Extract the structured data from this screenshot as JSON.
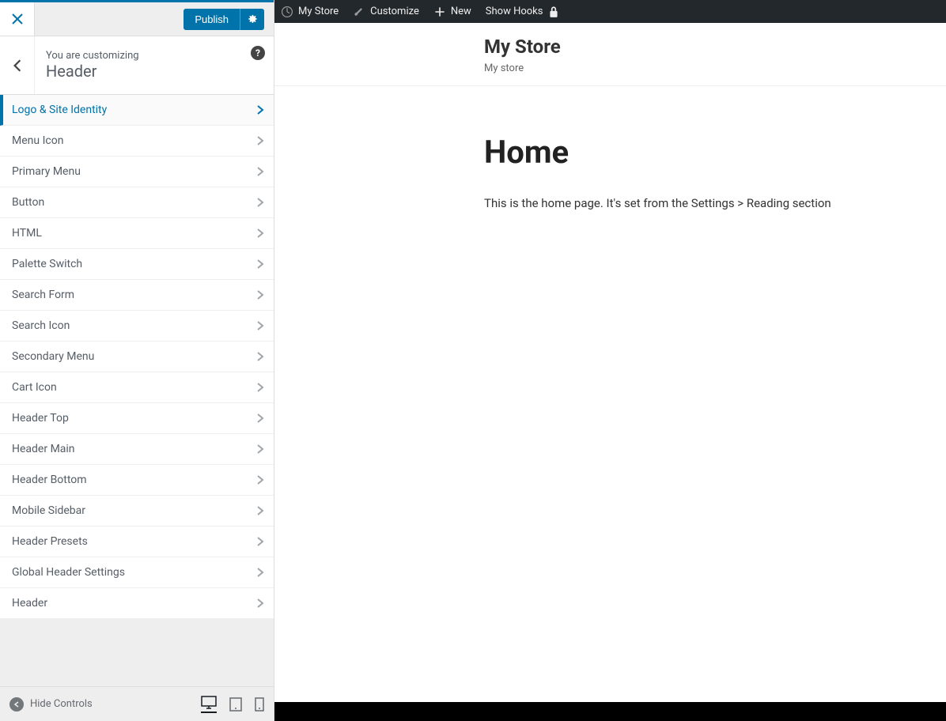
{
  "sidebar": {
    "publish_label": "Publish",
    "customizing_label": "You are customizing",
    "section_title": "Header",
    "items": [
      {
        "label": "Logo & Site Identity",
        "active": true
      },
      {
        "label": "Menu Icon"
      },
      {
        "label": "Primary Menu"
      },
      {
        "label": "Button"
      },
      {
        "label": "HTML"
      },
      {
        "label": "Palette Switch"
      },
      {
        "label": "Search Form"
      },
      {
        "label": "Search Icon"
      },
      {
        "label": "Secondary Menu"
      },
      {
        "label": "Cart Icon"
      },
      {
        "label": "Header Top"
      },
      {
        "label": "Header Main"
      },
      {
        "label": "Header Bottom"
      },
      {
        "label": "Mobile Sidebar"
      },
      {
        "label": "Header Presets"
      },
      {
        "label": "Global Header Settings"
      },
      {
        "label": "Header"
      }
    ],
    "hide_controls_label": "Hide Controls"
  },
  "adminbar": {
    "site_name": "My Store",
    "customize": "Customize",
    "new": "New",
    "show_hooks": "Show Hooks"
  },
  "page": {
    "site_title": "My Store",
    "site_tagline": "My store",
    "heading": "Home",
    "body": "This is the home page. It's set from the Settings > Reading section"
  }
}
